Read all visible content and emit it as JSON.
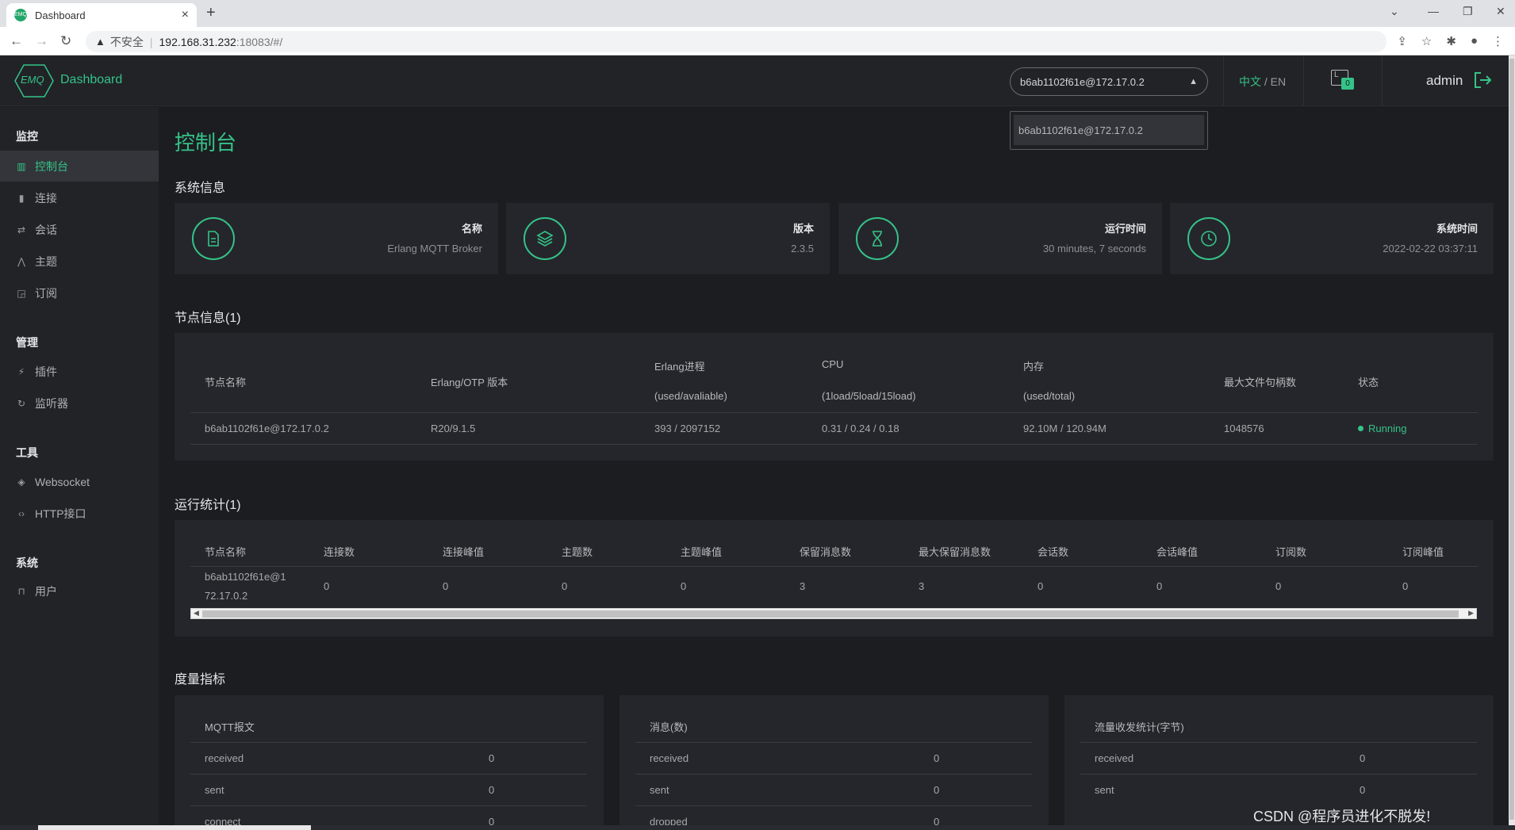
{
  "browser": {
    "tab_title": "Dashboard",
    "favicon_text": "EMQ",
    "url_warning": "不安全",
    "url_host": "192.168.31.232",
    "url_rest": ":18083/#/"
  },
  "header": {
    "logo_text": "EMQ",
    "title": "Dashboard",
    "node_select_value": "b6ab1102f61e@172.17.0.2",
    "lang_zh": "中文",
    "lang_sep": "/",
    "lang_en": "EN",
    "alarm_box_text": "L",
    "alarm_badge": "0",
    "user": "admin"
  },
  "dropdown": {
    "options": [
      "b6ab1102f61e@172.17.0.2"
    ]
  },
  "sidebar": {
    "groups": [
      {
        "title": "监控",
        "items": [
          "控制台",
          "连接",
          "会话",
          "主题",
          "订阅"
        ]
      },
      {
        "title": "管理",
        "items": [
          "插件",
          "监听器"
        ]
      },
      {
        "title": "工具",
        "items": [
          "Websocket",
          "HTTP接口"
        ]
      },
      {
        "title": "系统",
        "items": [
          "用户"
        ]
      }
    ]
  },
  "page": {
    "title": "控制台",
    "sys_info_title": "系统信息",
    "node_info_title": "节点信息(1)",
    "stats_title": "运行统计(1)",
    "metrics_title": "度量指标"
  },
  "sys_cards": [
    {
      "label": "名称",
      "value": "Erlang MQTT Broker"
    },
    {
      "label": "版本",
      "value": "2.3.5"
    },
    {
      "label": "运行时间",
      "value": "30 minutes, 7 seconds"
    },
    {
      "label": "系统时间",
      "value": "2022-02-22 03:37:11"
    }
  ],
  "node_table": {
    "headers": {
      "name": "节点名称",
      "otp": "Erlang/OTP 版本",
      "proc_1": "Erlang进程",
      "proc_2": "(used/avaliable)",
      "cpu_1": "CPU",
      "cpu_2": "(1load/5load/15load)",
      "mem_1": "内存",
      "mem_2": "(used/total)",
      "fd": "最大文件句柄数",
      "status": "状态"
    },
    "row": {
      "name": "b6ab1102f61e@172.17.0.2",
      "otp": "R20/9.1.5",
      "proc": "393 / 2097152",
      "cpu": "0.31 / 0.24 / 0.18",
      "mem": "92.10M / 120.94M",
      "fd": "1048576",
      "status": "Running"
    }
  },
  "stats_table": {
    "headers": [
      "节点名称",
      "连接数",
      "连接峰值",
      "主题数",
      "主题峰值",
      "保留消息数",
      "最大保留消息数",
      "会话数",
      "会话峰值",
      "订阅数",
      "订阅峰值"
    ],
    "row_name_1": "b6ab1102f61e@1",
    "row_name_2": "72.17.0.2",
    "values": [
      "0",
      "0",
      "0",
      "0",
      "3",
      "3",
      "0",
      "0",
      "0",
      "0"
    ]
  },
  "metrics": [
    {
      "title": "MQTT报文",
      "rows": [
        {
          "label": "received",
          "value": "0"
        },
        {
          "label": "sent",
          "value": "0"
        },
        {
          "label": "connect",
          "value": "0"
        }
      ]
    },
    {
      "title": "消息(数)",
      "rows": [
        {
          "label": "received",
          "value": "0"
        },
        {
          "label": "sent",
          "value": "0"
        },
        {
          "label": "dropped",
          "value": "0"
        }
      ]
    },
    {
      "title": "流量收发统计(字节)",
      "rows": [
        {
          "label": "received",
          "value": "0"
        },
        {
          "label": "sent",
          "value": "0"
        }
      ]
    }
  ],
  "watermark": "CSDN @程序员进化不脱发!",
  "colors": {
    "accent": "#34c388",
    "background": "#1c1d21",
    "panel": "#25262b",
    "sidebar": "#222327"
  }
}
